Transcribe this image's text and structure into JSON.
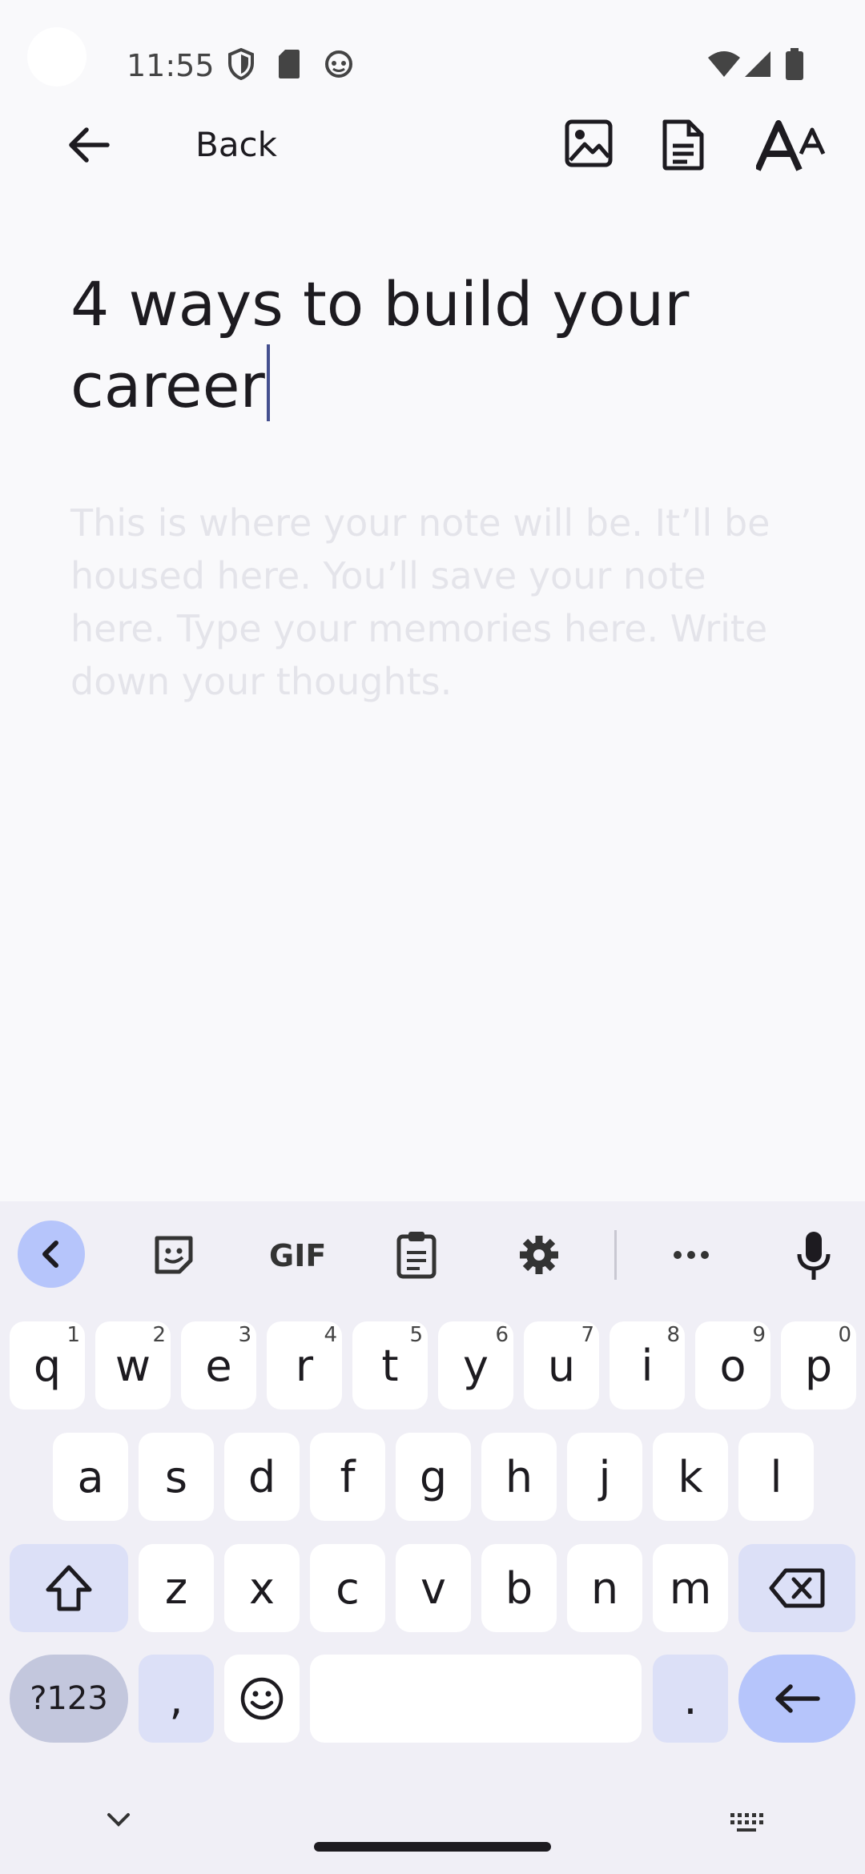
{
  "status_bar": {
    "time": "11:55"
  },
  "toolbar": {
    "back_label": "Back"
  },
  "note": {
    "title": "4 ways to build your career",
    "placeholder": "This is where your note will be. It’ll be housed here. You’ll save your note here. Type your memories here. Write down your thoughts."
  },
  "keyboard": {
    "row1": [
      {
        "k": "q",
        "h": "1"
      },
      {
        "k": "w",
        "h": "2"
      },
      {
        "k": "e",
        "h": "3"
      },
      {
        "k": "r",
        "h": "4"
      },
      {
        "k": "t",
        "h": "5"
      },
      {
        "k": "y",
        "h": "6"
      },
      {
        "k": "u",
        "h": "7"
      },
      {
        "k": "i",
        "h": "8"
      },
      {
        "k": "o",
        "h": "9"
      },
      {
        "k": "p",
        "h": "0"
      }
    ],
    "row2": [
      "a",
      "s",
      "d",
      "f",
      "g",
      "h",
      "j",
      "k",
      "l"
    ],
    "row3": [
      "z",
      "x",
      "c",
      "v",
      "b",
      "n",
      "m"
    ],
    "symbols_label": "?123",
    "comma": ",",
    "period": ".",
    "gif_label": "GIF"
  },
  "colors": {
    "accent": "#45508f",
    "key_mod": "#dce0f7",
    "enter": "#b6c5fb"
  }
}
